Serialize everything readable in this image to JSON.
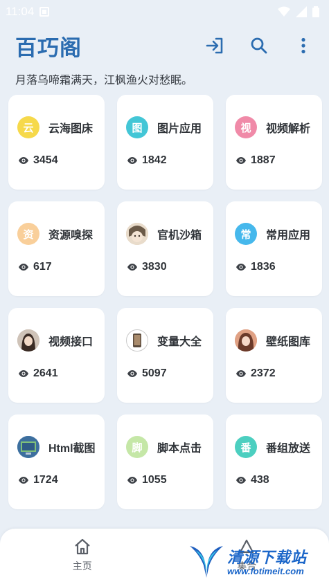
{
  "status_bar": {
    "time": "11:04"
  },
  "header": {
    "title": "百巧阁"
  },
  "subtitle": "月落乌啼霜满天，江枫渔火对愁眠。",
  "cards": [
    {
      "label": "云海图床",
      "views": "3454",
      "badge_text": "云",
      "badge_color": "#f6d94b",
      "icon": "text-badge"
    },
    {
      "label": "图片应用",
      "views": "1842",
      "badge_text": "图",
      "badge_color": "#43c6d6",
      "icon": "text-badge"
    },
    {
      "label": "视频解析",
      "views": "1887",
      "badge_text": "视",
      "badge_color": "#f08aa8",
      "icon": "text-badge"
    },
    {
      "label": "资源嗅探",
      "views": "617",
      "badge_text": "资",
      "badge_color": "#f9cf9a",
      "icon": "text-badge"
    },
    {
      "label": "官机沙箱",
      "views": "3830",
      "badge_text": "",
      "badge_color": "#d7c3aa",
      "icon": "anime-avatar"
    },
    {
      "label": "常用应用",
      "views": "1836",
      "badge_text": "常",
      "badge_color": "#46b8ec",
      "icon": "text-badge"
    },
    {
      "label": "视频接口",
      "views": "2641",
      "badge_text": "",
      "badge_color": "#bfae9f",
      "icon": "photo-avatar"
    },
    {
      "label": "变量大全",
      "views": "5097",
      "badge_text": "",
      "badge_color": "#ffffff",
      "icon": "phone-avatar"
    },
    {
      "label": "壁纸图库",
      "views": "2372",
      "badge_text": "",
      "badge_color": "#e8a98f",
      "icon": "photo-avatar"
    },
    {
      "label": "Html截图",
      "views": "1724",
      "badge_text": "",
      "badge_color": "#4a8fd6",
      "icon": "screen-avatar"
    },
    {
      "label": "脚本点击",
      "views": "1055",
      "badge_text": "脚",
      "badge_color": "#c5e7a7",
      "icon": "text-badge"
    },
    {
      "label": "番组放送",
      "views": "438",
      "badge_text": "番",
      "badge_color": "#4ccfc0",
      "icon": "text-badge"
    }
  ],
  "bottom_nav": {
    "home_label": "主页",
    "collection_label": "集合"
  },
  "watermark": {
    "title": "清源下载站",
    "url": "www.fotimeit.com"
  }
}
